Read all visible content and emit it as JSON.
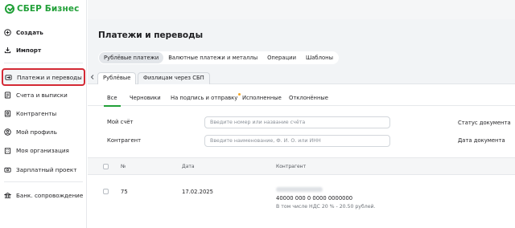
{
  "brand": {
    "name": "СБЕР Бизнес",
    "color": "#21a038"
  },
  "sidebar": {
    "create_label": "Создать",
    "import_label": "Импорт",
    "items": [
      {
        "label": "Платежи и переводы",
        "icon": "payments-icon",
        "active": true
      },
      {
        "label": "Счета и выписки",
        "icon": "accounts-icon"
      },
      {
        "label": "Контрагенты",
        "icon": "contractors-icon"
      },
      {
        "label": "Мой профиль",
        "icon": "profile-icon"
      },
      {
        "label": "Моя организация",
        "icon": "organization-icon"
      },
      {
        "label": "Зарплатный проект",
        "icon": "salary-icon"
      },
      {
        "label": "Банк. сопровождение",
        "icon": "bank-support-icon"
      }
    ]
  },
  "page": {
    "title": "Платежи и переводы",
    "segments": [
      "Рублёвые платежи",
      "Валютные платежи и металлы",
      "Операции",
      "Шаблоны"
    ],
    "active_segment": 0,
    "subtabs": [
      "Рублёвые",
      "Физлицам через СБП"
    ],
    "active_subtab": 0,
    "status_tabs": [
      "Все",
      "Черновики",
      "На подпись и отправку",
      "Исполненные",
      "Отклонённые"
    ],
    "active_status_tab": 0
  },
  "filters": {
    "account_label": "Мой счёт",
    "account_placeholder": "Введите номер или название счёта",
    "contractor_label": "Контрагент",
    "contractor_placeholder": "Введите наименование, Ф. И. О. или ИНН",
    "status_label": "Статус документа",
    "date_label": "Дата документа"
  },
  "table": {
    "headers": {
      "number": "№",
      "date": "Дата",
      "contractor": "Контрагент"
    },
    "rows": [
      {
        "number": "75",
        "date": "17.02.2025",
        "account": "40000 000 0 0000 0000000",
        "vat_note": "В том числе НДС 20 % - 20.50 рублей."
      }
    ]
  },
  "colors": {
    "accent": "#21a038",
    "highlight": "#d42a35",
    "badge": "#f5a623"
  }
}
